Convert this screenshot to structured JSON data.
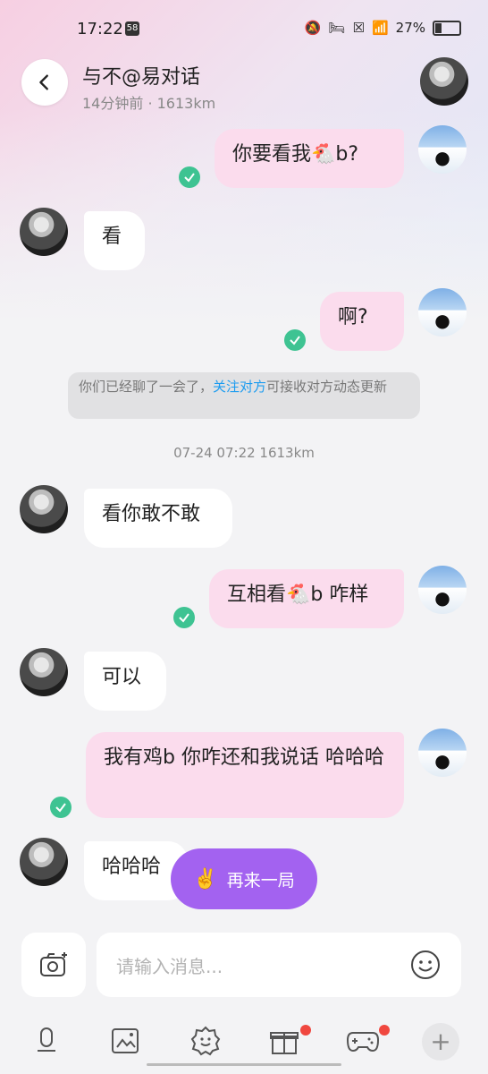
{
  "status": {
    "time": "17:22",
    "chip": "58",
    "battery_pct": "27%"
  },
  "header": {
    "title": "与不@易对话",
    "subtitle": "14分钟前 · 1613km"
  },
  "messages": {
    "m1": "你要看我🐔b?",
    "m2": "看",
    "m3": "啊?",
    "m4": "看你敢不敢",
    "m5": "互相看🐔b 咋样",
    "m6": "可以",
    "m7": "我有鸡b 你咋还和我说话 哈哈哈",
    "m8": "哈哈哈"
  },
  "notice": {
    "prefix": "你们已经聊了一会了，",
    "link": "关注对方",
    "suffix": "可接收对方动态更新"
  },
  "timestamp": "07-24 07:22  1613km",
  "replay": {
    "label": "再来一局",
    "icon": "✌️"
  },
  "composer": {
    "placeholder": "请输入消息..."
  },
  "tabs": [
    {
      "icon": "microphone-icon"
    },
    {
      "icon": "image-icon"
    },
    {
      "icon": "sticker-icon"
    },
    {
      "icon": "gift-icon"
    },
    {
      "icon": "gamepad-icon"
    },
    {
      "icon": "plus-icon"
    }
  ],
  "colors": {
    "outgoing": "#fbdced",
    "incoming": "#ffffff",
    "check": "#3ec392",
    "link": "#1d9cf0",
    "replay": "#a362f0"
  }
}
